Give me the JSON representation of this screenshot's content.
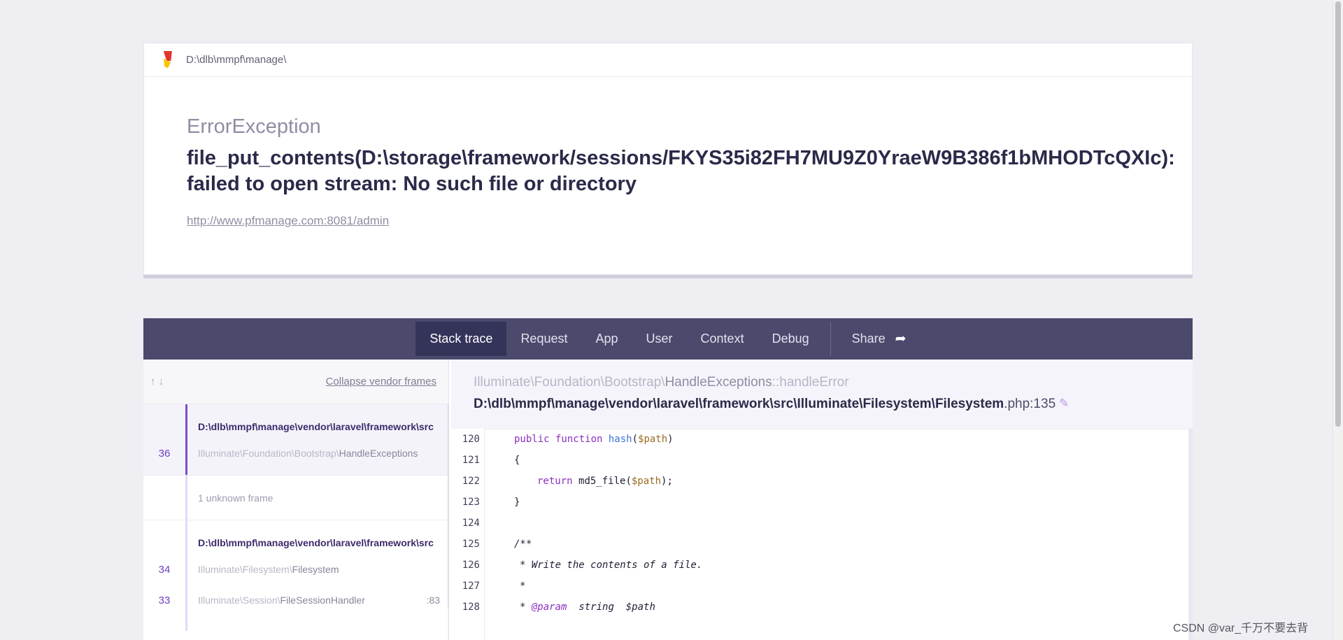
{
  "header": {
    "path": "D:\\dlb\\mmpf\\manage\\",
    "exception_class": "ErrorException",
    "exception_message": "file_put_contents(D:\\storage\\framework/sessions/FKYS35i82FH7MU9Z0YraeW9B386f1bMHODTcQXIc): failed to open stream: No such file or directory",
    "url": "http://www.pfmanage.com:8081/admin"
  },
  "tabs": [
    {
      "label": "Stack trace",
      "active": true
    },
    {
      "label": "Request"
    },
    {
      "label": "App"
    },
    {
      "label": "User"
    },
    {
      "label": "Context"
    },
    {
      "label": "Debug"
    },
    {
      "label": "Share",
      "icon": "share-arrow-icon"
    }
  ],
  "trace": {
    "collapse_label": "Collapse vendor frames",
    "frames": [
      {
        "number": "36",
        "file": "D:\\dlb\\mmpf\\manage\\vendor\\laravel\\framework\\src",
        "ns": "Illuminate\\Foundation\\Bootstrap\\",
        "cls": "HandleExceptions",
        "line": ""
      },
      {
        "unknown": "1 unknown frame"
      },
      {
        "number": "34",
        "file": "D:\\dlb\\mmpf\\manage\\vendor\\laravel\\framework\\src",
        "ns": "Illuminate\\Filesystem\\",
        "cls": "Filesystem",
        "line": ""
      },
      {
        "number": "33",
        "ns": "Illuminate\\Session\\",
        "cls": "FileSessionHandler",
        "line": ":83"
      }
    ]
  },
  "detail": {
    "ns": "Illuminate\\Foundation\\Bootstrap\\",
    "cls": "HandleExceptions",
    "method": "::handleError",
    "file": "D:\\dlb\\mmpf\\manage\\vendor\\laravel\\framework\\src\\Illuminate\\Filesystem\\Filesystem",
    "file_suffix": ".php:135"
  },
  "code_lines": [
    {
      "n": "120",
      "text": "public function hash($path)"
    },
    {
      "n": "121",
      "text": "{"
    },
    {
      "n": "122",
      "text": "return md5_file($path);"
    },
    {
      "n": "123",
      "text": "}"
    },
    {
      "n": "124",
      "text": ""
    },
    {
      "n": "125",
      "text": "/**"
    },
    {
      "n": "126",
      "text": "* Write the contents of a file."
    },
    {
      "n": "127",
      "text": "*"
    },
    {
      "n": "128",
      "text": "* @param  string  $path"
    }
  ],
  "watermark": "CSDN @var_千万不要去背"
}
